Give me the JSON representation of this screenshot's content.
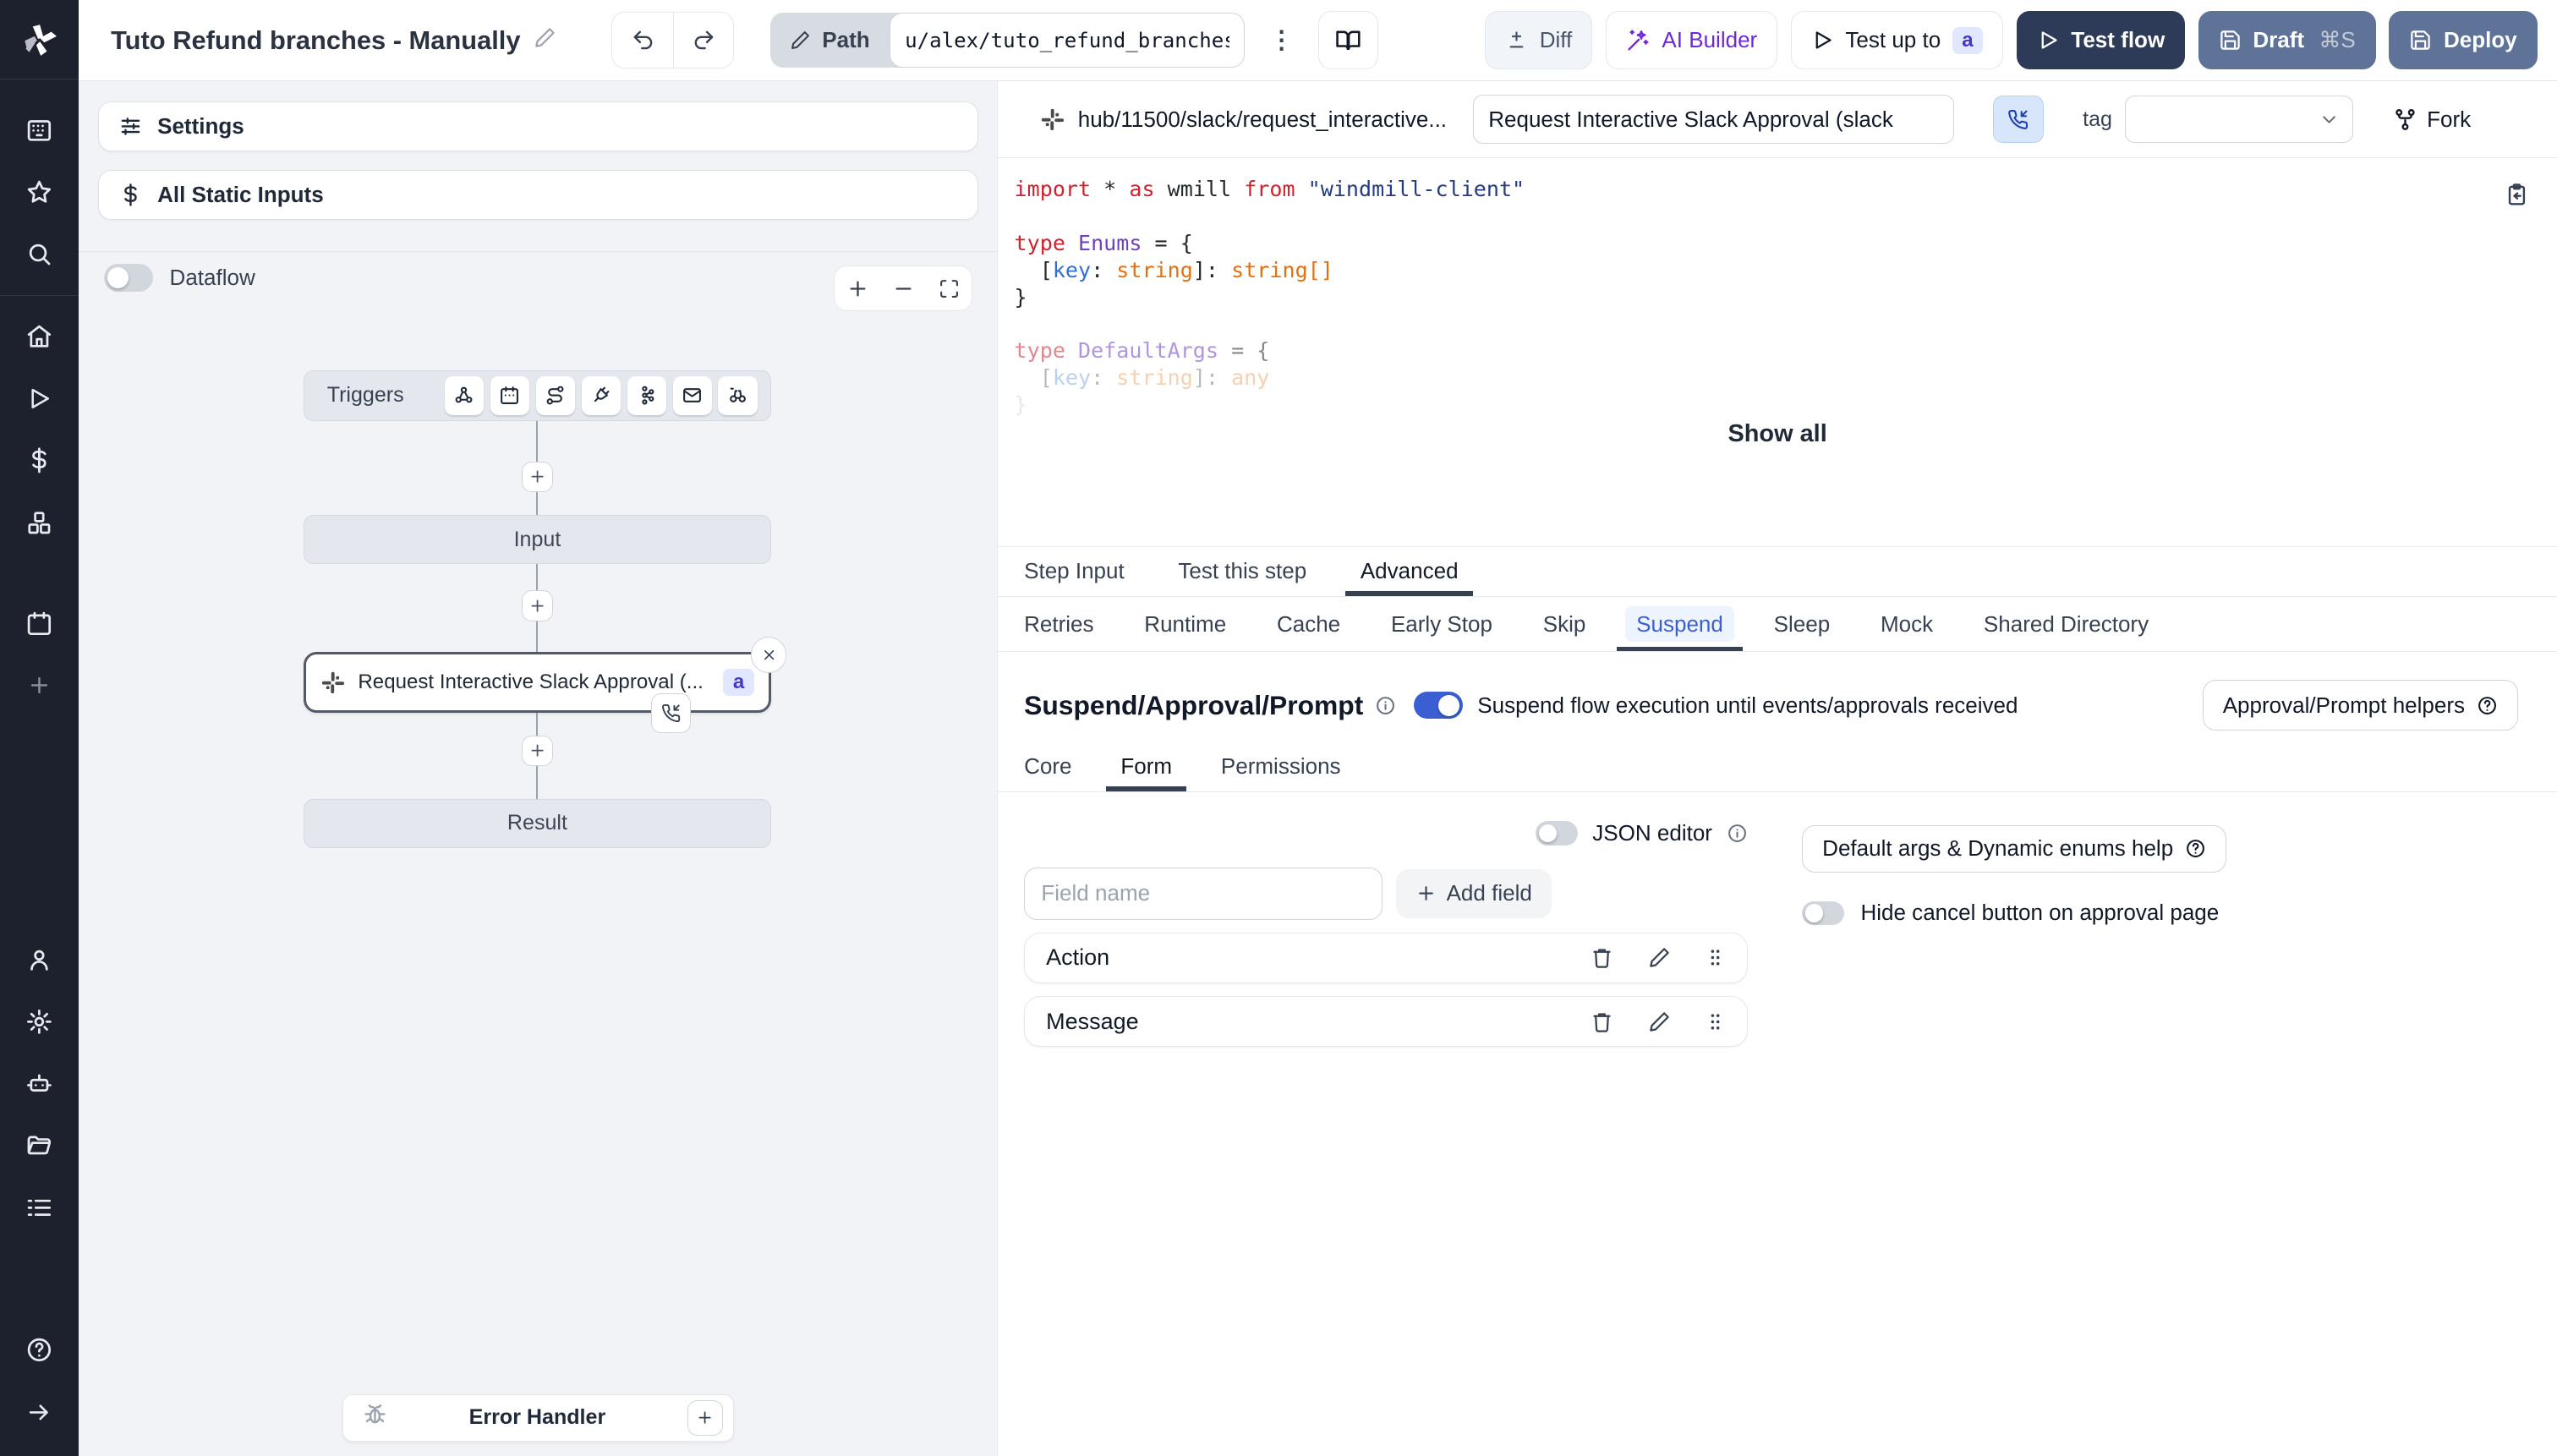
{
  "topbar": {
    "title": "Tuto Refund branches - Manually",
    "path_label": "Path",
    "path_value": "u/alex/tuto_refund_branches_",
    "diff_label": "Diff",
    "ai_builder_label": "AI Builder",
    "test_up_to_label": "Test up to",
    "test_up_to_badge": "a",
    "test_flow_label": "Test flow",
    "draft_label": "Draft",
    "draft_shortcut": "⌘S",
    "deploy_label": "Deploy"
  },
  "flow": {
    "settings_label": "Settings",
    "static_inputs_label": "All Static Inputs",
    "dataflow_label": "Dataflow",
    "triggers_label": "Triggers",
    "input_node_label": "Input",
    "step_node_label": "Request Interactive Slack Approval (...",
    "step_node_badge": "a",
    "result_node_label": "Result",
    "error_handler_label": "Error Handler"
  },
  "editor": {
    "hub_path": "hub/11500/slack/request_interactive...",
    "summary_value": "Request Interactive Slack Approval (slack",
    "tag_label": "tag",
    "fork_label": "Fork",
    "show_all_label": "Show all",
    "code_lines": [
      [
        [
          "kw",
          "import"
        ],
        [
          "pl",
          " * "
        ],
        [
          "kw",
          "as"
        ],
        [
          "pl",
          " wmill "
        ],
        [
          "kw",
          "from"
        ],
        [
          "st",
          " \"windmill-client\""
        ]
      ],
      [],
      [
        [
          "kw",
          "type"
        ],
        [
          "ty",
          " Enums"
        ],
        [
          "pl",
          " = {"
        ]
      ],
      [
        [
          "pl",
          "  ["
        ],
        [
          "pr",
          "key"
        ],
        [
          "pl",
          ": "
        ],
        [
          "or",
          "string"
        ],
        [
          "pl",
          "]: "
        ],
        [
          "or",
          "string[]"
        ]
      ],
      [
        [
          "pl",
          "}"
        ]
      ],
      [],
      [
        [
          "kw",
          "type"
        ],
        [
          "ty",
          " DefaultArgs"
        ],
        [
          "pl",
          " = {"
        ]
      ],
      [
        [
          "pl",
          "  ["
        ],
        [
          "pr",
          "key"
        ],
        [
          "pl",
          ": "
        ],
        [
          "or",
          "string"
        ],
        [
          "pl",
          "]: "
        ],
        [
          "or",
          "any"
        ]
      ],
      [
        [
          "pl",
          "}"
        ]
      ]
    ]
  },
  "tabs": {
    "main": [
      "Step Input",
      "Test this step",
      "Advanced"
    ],
    "main_active": "Advanced",
    "advanced": [
      "Retries",
      "Runtime",
      "Cache",
      "Early Stop",
      "Skip",
      "Suspend",
      "Sleep",
      "Mock",
      "Shared Directory"
    ],
    "advanced_active": "Suspend"
  },
  "suspend": {
    "title": "Suspend/Approval/Prompt",
    "description": "Suspend flow execution until events/approvals received",
    "helpers_label": "Approval/Prompt helpers",
    "subtabs": [
      "Core",
      "Form",
      "Permissions"
    ],
    "subtab_active": "Form",
    "json_editor_label": "JSON editor",
    "field_name_placeholder": "Field name",
    "add_field_label": "Add field",
    "default_args_label": "Default args & Dynamic enums help",
    "hide_cancel_label": "Hide cancel button on approval page",
    "fields": [
      {
        "name": "Action"
      },
      {
        "name": "Message"
      }
    ]
  },
  "colors": {
    "accent_blue": "#3b5fd3",
    "badge_indigo_bg": "#e0e7ff",
    "badge_indigo_text": "#4338ca",
    "test_flow_bg": "#2d3a58",
    "deploy_bg": "#5e7397",
    "ai_builder_purple": "#6d28d9",
    "sidebar_bg": "#1d212d"
  }
}
